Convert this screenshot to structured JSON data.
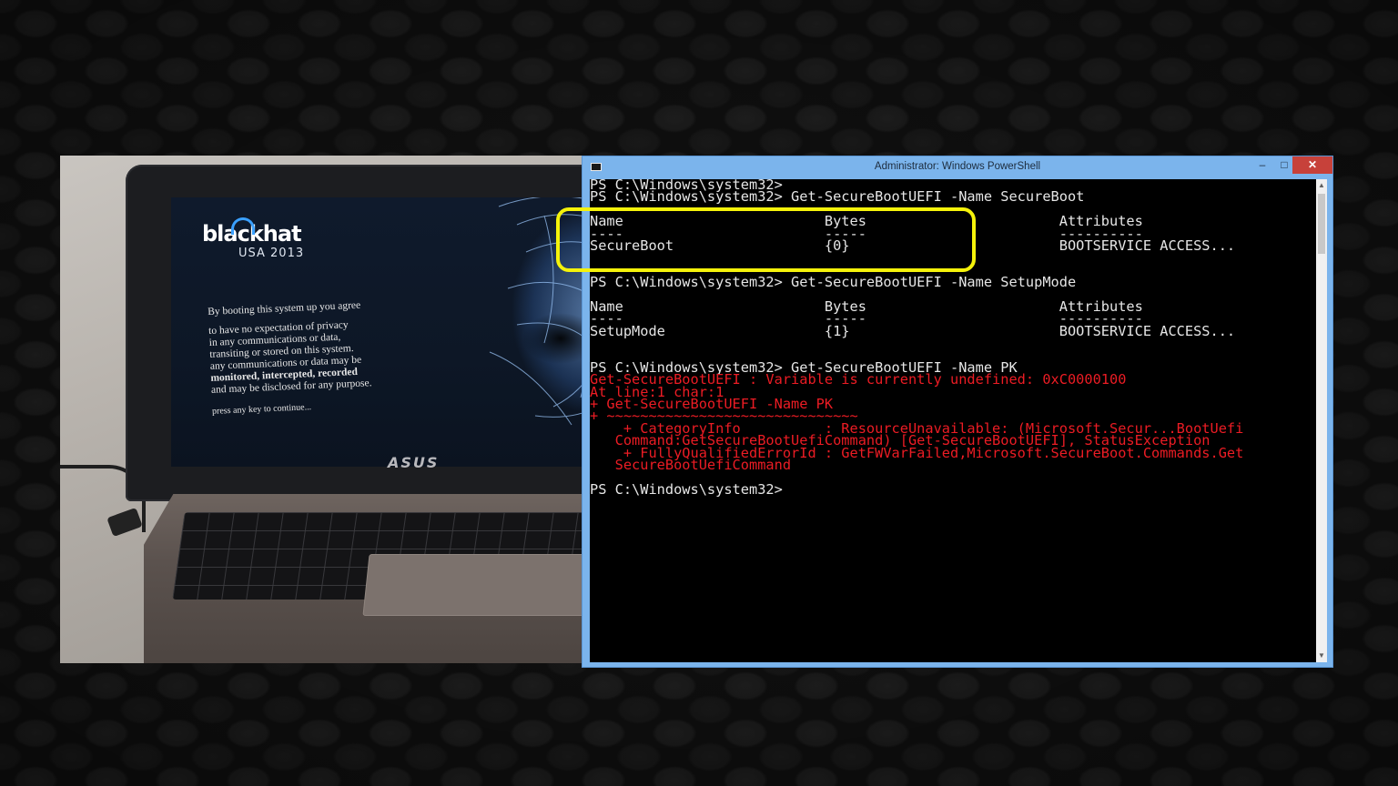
{
  "photo": {
    "logo_word": "blackhat",
    "logo_sub": "USA 2013",
    "banner_lines": [
      "By booting this system up you agree",
      "to have no expectation of privacy",
      "in any communications or data,",
      "transiting or stored on this system.",
      "any communications or data may be",
      "monitored, intercepted, recorded",
      "and may be disclosed for any purpose."
    ],
    "press_key": "press any key to continue...",
    "brand": "ASUS"
  },
  "window": {
    "title": "Administrator: Windows PowerShell",
    "icon": "powershell-console-icon",
    "minimize": "–",
    "maximize": "□",
    "close": "✕",
    "scroll_up": "▲",
    "scroll_down": "▼"
  },
  "console": {
    "lines": [
      {
        "text": "PS C:\\Windows\\system32>",
        "type": "normal"
      },
      {
        "text": "PS C:\\Windows\\system32> Get-SecureBootUEFI -Name SecureBoot",
        "type": "normal"
      },
      {
        "text": "",
        "type": "normal"
      },
      {
        "text": "Name                        Bytes                       Attributes",
        "type": "normal"
      },
      {
        "text": "----                        -----                       ----------",
        "type": "normal"
      },
      {
        "text": "SecureBoot                  {0}                         BOOTSERVICE ACCESS...",
        "type": "normal"
      },
      {
        "text": "",
        "type": "normal"
      },
      {
        "text": "",
        "type": "normal"
      },
      {
        "text": "PS C:\\Windows\\system32> Get-SecureBootUEFI -Name SetupMode",
        "type": "normal"
      },
      {
        "text": "",
        "type": "normal"
      },
      {
        "text": "Name                        Bytes                       Attributes",
        "type": "normal"
      },
      {
        "text": "----                        -----                       ----------",
        "type": "normal"
      },
      {
        "text": "SetupMode                   {1}                         BOOTSERVICE ACCESS...",
        "type": "normal"
      },
      {
        "text": "",
        "type": "normal"
      },
      {
        "text": "",
        "type": "normal"
      },
      {
        "text": "PS C:\\Windows\\system32> Get-SecureBootUEFI -Name PK",
        "type": "normal"
      },
      {
        "text": "Get-SecureBootUEFI : Variable is currently undefined: 0xC0000100",
        "type": "err"
      },
      {
        "text": "At line:1 char:1",
        "type": "err"
      },
      {
        "text": "+ Get-SecureBootUEFI -Name PK",
        "type": "err"
      },
      {
        "text": "+ ~~~~~~~~~~~~~~~~~~~~~~~~~~~~~~",
        "type": "err"
      },
      {
        "text": "    + CategoryInfo          : ResourceUnavailable: (Microsoft.Secur...BootUefi",
        "type": "err"
      },
      {
        "text": "   Command:GetSecureBootUefiCommand) [Get-SecureBootUEFI], StatusException",
        "type": "err"
      },
      {
        "text": "    + FullyQualifiedErrorId : GetFWVarFailed,Microsoft.SecureBoot.Commands.Get",
        "type": "err"
      },
      {
        "text": "   SecureBootUefiCommand",
        "type": "err"
      },
      {
        "text": "",
        "type": "normal"
      },
      {
        "text": "PS C:\\Windows\\system32>",
        "type": "normal"
      }
    ]
  },
  "colors": {
    "window_frame": "#7bb4ec",
    "close_button": "#c7413a",
    "error_text": "#ec1c24",
    "highlight": "#f5f20a"
  }
}
